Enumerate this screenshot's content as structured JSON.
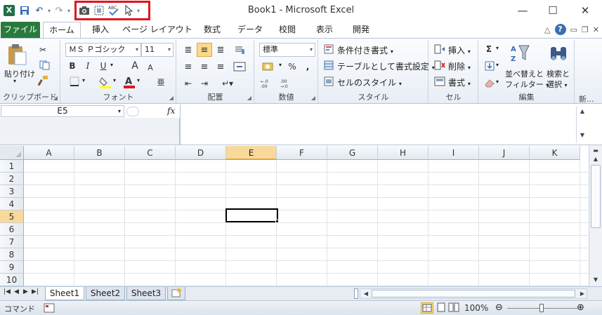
{
  "app": {
    "title": "Book1  -  Microsoft Excel",
    "icon_letter": "X"
  },
  "qat": {
    "items": [
      "save-icon",
      "undo-icon",
      "redo-icon",
      "camera-icon",
      "select-objects-icon",
      "spelling-icon",
      "pointer-icon"
    ]
  },
  "window_controls": {
    "minimize": "—",
    "maximize": "☐",
    "close": "✕"
  },
  "tabs": {
    "file": "ファイル",
    "items": [
      "ホーム",
      "挿入",
      "ページ レイアウト",
      "数式",
      "データ",
      "校閲",
      "表示",
      "開発"
    ]
  },
  "clipboard": {
    "paste": "貼り付け",
    "label": "クリップボード"
  },
  "font": {
    "name": "ＭＳ Ｐゴシック",
    "size": "11",
    "bold": "B",
    "italic": "I",
    "underline": "U",
    "grow": "A",
    "shrink": "A",
    "label": "フォント"
  },
  "alignment": {
    "label": "配置"
  },
  "number": {
    "format": "標準",
    "percent": "%",
    "comma": ",",
    "label": "数値"
  },
  "styles": {
    "conditional": "条件付き書式",
    "table": "テーブルとして書式設定",
    "cell": "セルのスタイル",
    "label": "スタイル"
  },
  "cells": {
    "insert": "挿入",
    "delete": "削除",
    "format": "書式",
    "label": "セル"
  },
  "editing": {
    "sum_symbol": "Σ",
    "sort_line1": "並べ替えと",
    "sort_line2": "フィルター",
    "find_line1": "検索と",
    "find_line2": "選択",
    "label": "編集",
    "new_label": "新..."
  },
  "formula_bar": {
    "name_box": "E5",
    "fx": "fx",
    "content": ""
  },
  "grid": {
    "columns": [
      "A",
      "B",
      "C",
      "D",
      "E",
      "F",
      "G",
      "H",
      "I",
      "J",
      "K"
    ],
    "rows": [
      "1",
      "2",
      "3",
      "4",
      "5",
      "6",
      "7",
      "8",
      "9",
      "10"
    ],
    "active_column": "E",
    "active_row": "5"
  },
  "sheets": {
    "tabs": [
      "Sheet1",
      "Sheet2",
      "Sheet3"
    ],
    "active": "Sheet1"
  },
  "status": {
    "mode": "コマンド",
    "zoom": "100%"
  },
  "colors": {
    "file_tab": "#2a7a3d",
    "highlight": "#e0151d",
    "active_header": "#f9d99b"
  }
}
